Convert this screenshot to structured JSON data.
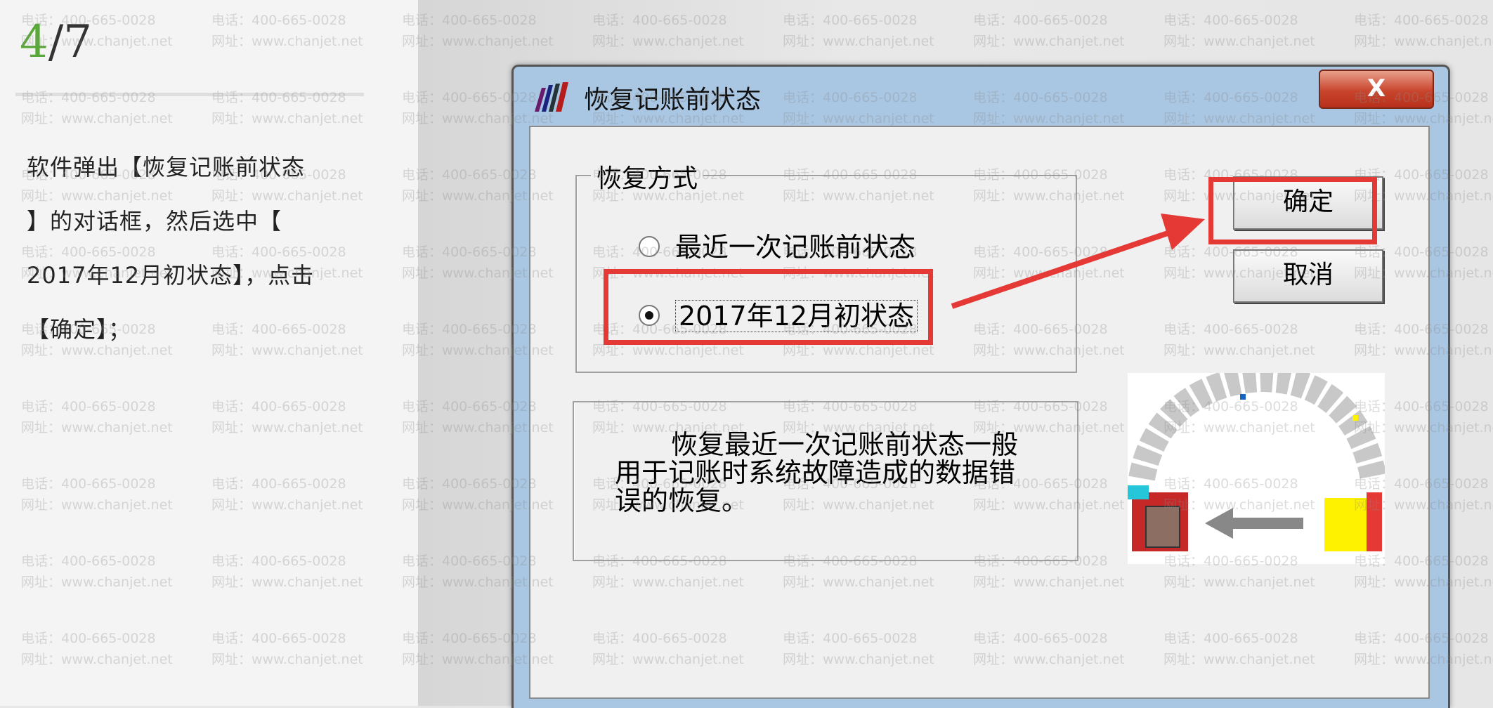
{
  "step": {
    "current": "4",
    "total": "/7"
  },
  "instruction_lines": [
    "软件弹出【恢复记账前状态",
    "】的对话框，然后选中【",
    "2017年12月初状态】，点击",
    "【确定】；"
  ],
  "watermark": {
    "phone": "电话：400-665-0028",
    "site": "网址：www.chanjet.net"
  },
  "dialog": {
    "title": "恢复记账前状态",
    "close_label": "X",
    "group_label": "恢复方式",
    "options": [
      {
        "label": "最近一次记账前状态",
        "selected": false
      },
      {
        "label": "2017年12月初状态",
        "selected": true
      }
    ],
    "ok_label": "确定",
    "cancel_label": "取消",
    "description": "恢复最近一次记账前状态一般用于记账时系统故障造成的数据错误的恢复。"
  },
  "colors": {
    "highlight": "#e53935",
    "step_accent": "#5aa83a",
    "title_bar": "#a9c6e3"
  }
}
